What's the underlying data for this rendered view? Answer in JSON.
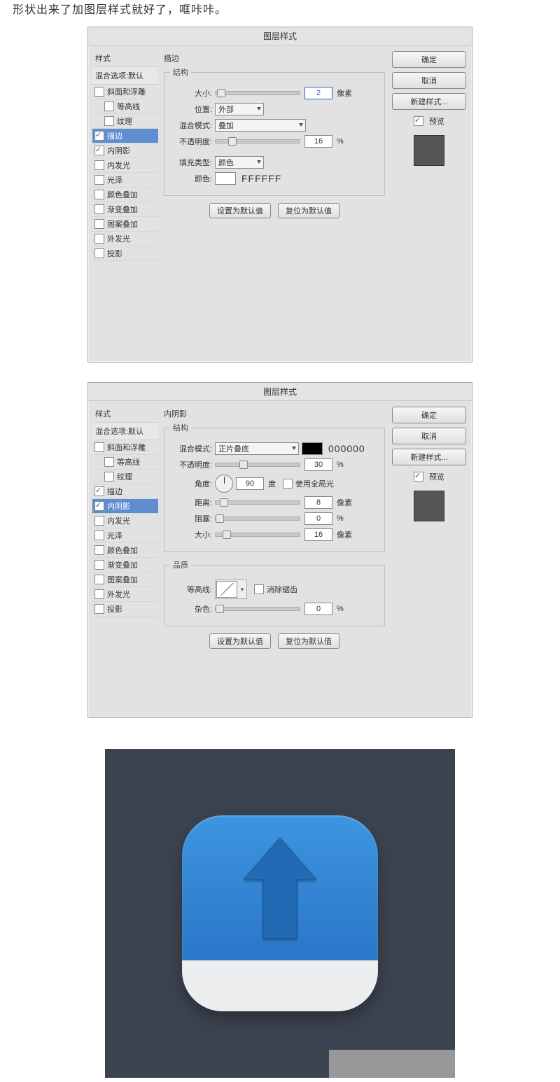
{
  "top_text": "形状出来了加图层样式就好了，哐咔咔。",
  "dialog_title": "图层样式",
  "side": {
    "header": "样式",
    "sub": "混合选项:默认",
    "items": [
      {
        "label": "斜面和浮雕",
        "checked": false,
        "indent": false
      },
      {
        "label": "等高线",
        "checked": false,
        "indent": true
      },
      {
        "label": "纹理",
        "checked": false,
        "indent": true
      },
      {
        "label": "描边",
        "checked": true,
        "indent": false
      },
      {
        "label": "内阴影",
        "checked": true,
        "indent": false
      },
      {
        "label": "内发光",
        "checked": false,
        "indent": false
      },
      {
        "label": "光泽",
        "checked": false,
        "indent": false
      },
      {
        "label": "颜色叠加",
        "checked": false,
        "indent": false
      },
      {
        "label": "渐变叠加",
        "checked": false,
        "indent": false
      },
      {
        "label": "图案叠加",
        "checked": false,
        "indent": false
      },
      {
        "label": "外发光",
        "checked": false,
        "indent": false
      },
      {
        "label": "投影",
        "checked": false,
        "indent": false
      }
    ],
    "selected_d1": 3,
    "selected_d2": 4
  },
  "buttons": {
    "ok": "确定",
    "cancel": "取消",
    "new_style": "新建样式...",
    "preview": "预览",
    "set_default": "设置为默认值",
    "reset_default": "复位为默认值"
  },
  "stroke": {
    "section": "描边",
    "group": "结构",
    "size_label": "大小:",
    "size_value": "2",
    "size_unit": "像素",
    "position_label": "位置:",
    "position_value": "外部",
    "blend_label": "混合模式:",
    "blend_value": "叠加",
    "opacity_label": "不透明度:",
    "opacity_value": "16",
    "opacity_unit": "%",
    "fill_label": "填充类型:",
    "fill_value": "颜色",
    "color_label": "颜色:",
    "color_hex": "FFFFFF"
  },
  "inner": {
    "section": "内阴影",
    "group": "结构",
    "blend_label": "混合模式:",
    "blend_value": "正片叠底",
    "color_hex": "000000",
    "opacity_label": "不透明度:",
    "opacity_value": "30",
    "opacity_unit": "%",
    "angle_label": "角度:",
    "angle_value": "90",
    "angle_unit": "度",
    "global_label": "使用全局光",
    "distance_label": "距离:",
    "distance_value": "8",
    "distance_unit": "像素",
    "choke_label": "阻塞:",
    "choke_value": "0",
    "choke_unit": "%",
    "size_label": "大小:",
    "size_value": "16",
    "size_unit": "像素",
    "quality_group": "品质",
    "contour_label": "等高线:",
    "antialias_label": "消除锯齿",
    "noise_label": "杂色:",
    "noise_value": "0",
    "noise_unit": "%"
  }
}
